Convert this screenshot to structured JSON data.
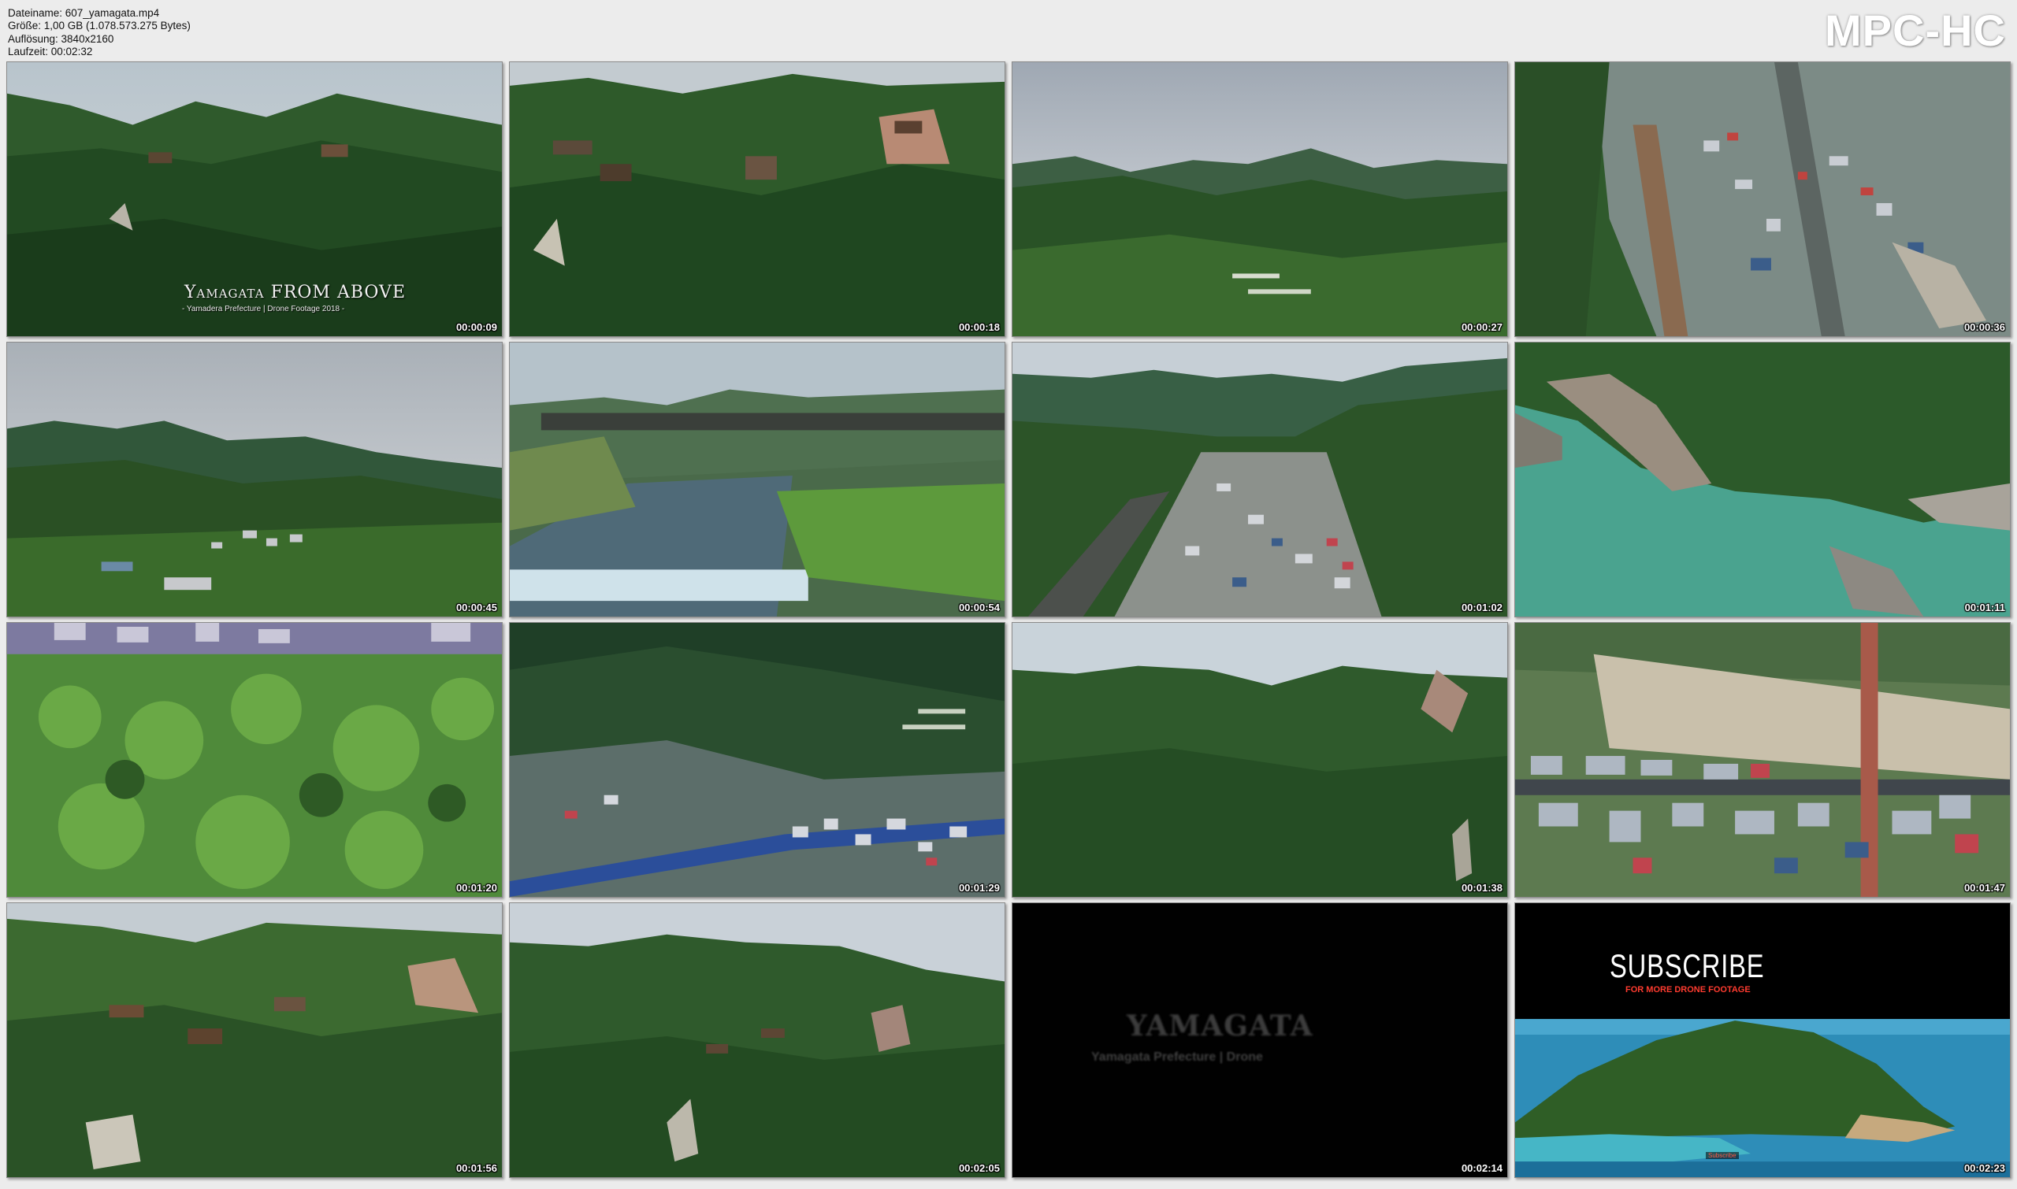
{
  "file_info": {
    "filename": "Dateiname: 607_yamagata.mp4",
    "size": "Größe: 1,00 GB (1.078.573.275 Bytes)",
    "resolution": "Auflösung: 3840x2160",
    "duration": "Laufzeit: 00:02:32"
  },
  "brand": "MPC-HC",
  "thumbnails": [
    {
      "time": "00:00:09",
      "scene": "mountain-temple"
    },
    {
      "time": "00:00:18",
      "scene": "mountain-temple-close"
    },
    {
      "time": "00:00:27",
      "scene": "mountain-range-cloudy"
    },
    {
      "time": "00:00:36",
      "scene": "town-aerial"
    },
    {
      "time": "00:00:45",
      "scene": "valley-village"
    },
    {
      "time": "00:00:54",
      "scene": "river-weir"
    },
    {
      "time": "00:01:02",
      "scene": "valley-town"
    },
    {
      "time": "00:01:11",
      "scene": "turquoise-river"
    },
    {
      "time": "00:01:20",
      "scene": "forest-canopy"
    },
    {
      "time": "00:01:29",
      "scene": "town-hillside"
    },
    {
      "time": "00:01:38",
      "scene": "forested-ridge"
    },
    {
      "time": "00:01:47",
      "scene": "town-topdown"
    },
    {
      "time": "00:01:56",
      "scene": "temple-cliffs"
    },
    {
      "time": "00:02:05",
      "scene": "forest-hill"
    },
    {
      "time": "00:02:14",
      "scene": "title-fade"
    },
    {
      "time": "00:02:23",
      "scene": "subscribe-island"
    }
  ],
  "overlays": {
    "intro_title_1": "Yamagata",
    "intro_title_2": "FROM ABOVE",
    "intro_subtitle": "- Yamadera Prefecture | Drone Footage 2018 -",
    "fade_title": "YAMAGATA",
    "fade_subtitle": "Yamagata Prefecture | Drone",
    "subscribe": "SUBSCRIBE",
    "subscribe_tag": "FOR MORE DRONE FOOTAGE",
    "subscribe_credit": "Subscribe"
  }
}
